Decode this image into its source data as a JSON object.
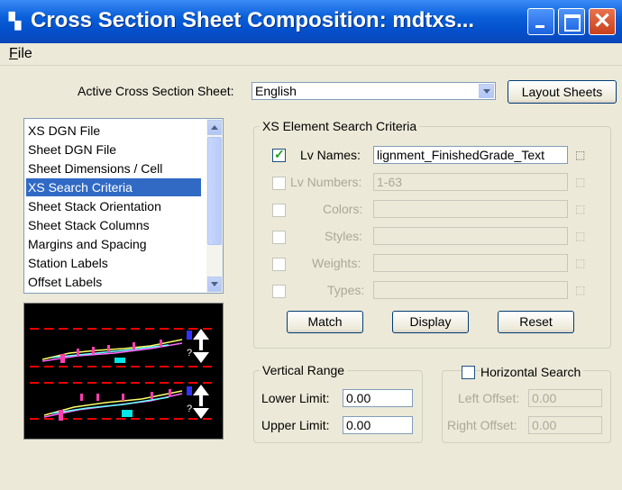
{
  "window": {
    "title": "Cross Section Sheet Composition: mdtxs...",
    "icon": "app-icon"
  },
  "menu": {
    "file": "File"
  },
  "active_sheet": {
    "label": "Active Cross Section Sheet:",
    "value": "English"
  },
  "buttons": {
    "layout_sheets": "Layout Sheets",
    "match": "Match",
    "display": "Display",
    "reset": "Reset"
  },
  "categories": {
    "items": [
      "XS DGN File",
      "Sheet DGN File",
      "Sheet Dimensions / Cell",
      "XS Search Criteria",
      "Sheet Stack Orientation",
      "Sheet Stack Columns",
      "Margins and Spacing",
      "Station Labels",
      "Offset Labels"
    ],
    "selected": "XS Search Criteria"
  },
  "search": {
    "group_label": "XS Element Search Criteria",
    "rows": [
      {
        "label": "Lv Names:",
        "value": "lignment_FinishedGrade_Text",
        "checked": true,
        "enabled": true
      },
      {
        "label": "Lv Numbers:",
        "value": "1-63",
        "checked": false,
        "enabled": false
      },
      {
        "label": "Colors:",
        "value": "",
        "checked": false,
        "enabled": false
      },
      {
        "label": "Styles:",
        "value": "",
        "checked": false,
        "enabled": false
      },
      {
        "label": "Weights:",
        "value": "",
        "checked": false,
        "enabled": false
      },
      {
        "label": "Types:",
        "value": "",
        "checked": false,
        "enabled": false
      }
    ]
  },
  "vertical_range": {
    "group_label": "Vertical Range",
    "lower_label": "Lower Limit:",
    "lower_value": "0.00",
    "upper_label": "Upper Limit:",
    "upper_value": "0.00"
  },
  "horizontal_search": {
    "group_label": "Horizontal Search",
    "checked": false,
    "left_label": "Left Offset:",
    "left_value": "0.00",
    "right_label": "Right Offset:",
    "right_value": "0.00"
  },
  "colors": {
    "titlebar": "#0a5fd8",
    "selection": "#316ac5",
    "preview_bg": "#000000"
  }
}
